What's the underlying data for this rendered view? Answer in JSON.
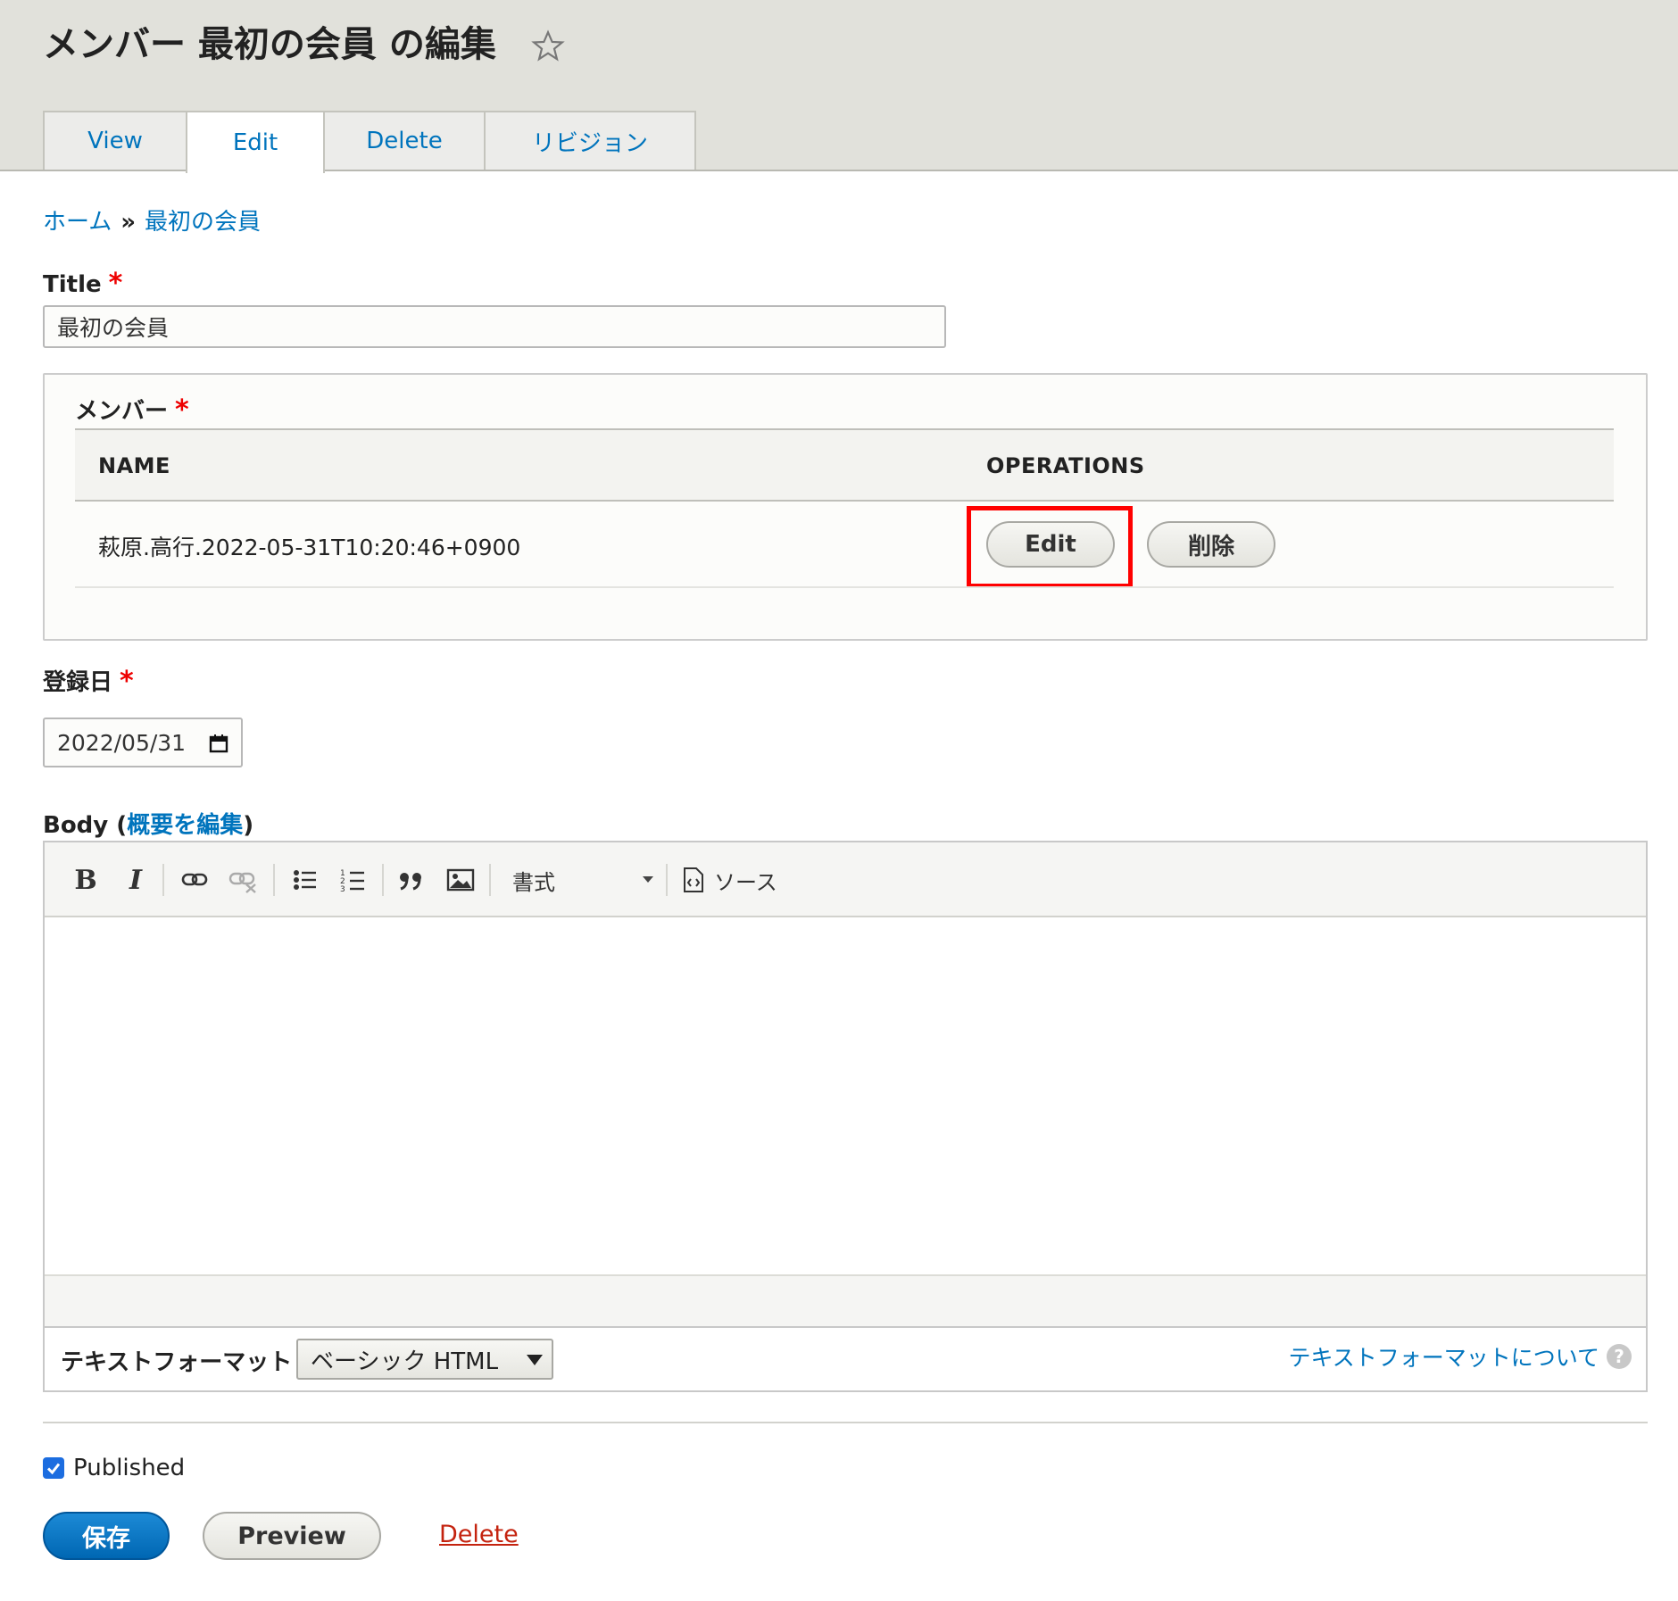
{
  "header": {
    "title": "メンバー 最初の会員 の編集",
    "tabs": [
      {
        "label": "View",
        "active": false
      },
      {
        "label": "Edit",
        "active": true
      },
      {
        "label": "Delete",
        "active": false
      },
      {
        "label": "リビジョン",
        "active": false
      }
    ]
  },
  "breadcrumb": {
    "items": [
      "ホーム",
      "最初の会員"
    ],
    "separator": "»"
  },
  "title_field": {
    "label": "Title",
    "required_mark": "*",
    "value": "最初の会員"
  },
  "member_field": {
    "label": "メンバー",
    "required_mark": "*",
    "columns": [
      "NAME",
      "OPERATIONS"
    ],
    "rows": [
      {
        "name": "萩原.高行.2022-05-31T10:20:46+0900",
        "edit_label": "Edit",
        "delete_label": "削除"
      }
    ]
  },
  "date_field": {
    "label": "登録日",
    "required_mark": "*",
    "value": "2022/05/31"
  },
  "body_field": {
    "label": "Body",
    "summary_link": "概要を編集",
    "toolbar": {
      "bold": "B",
      "italic": "I",
      "format_label": "書式",
      "source_label": "ソース"
    },
    "text_format_label": "テキストフォーマット",
    "text_format_value": "ベーシック HTML",
    "text_format_help": "テキストフォーマットについて",
    "help_icon": "?"
  },
  "published": {
    "label": "Published",
    "checked": true
  },
  "actions": {
    "save": "保存",
    "preview": "Preview",
    "delete": "Delete"
  },
  "colors": {
    "link": "#0074bd",
    "primary": "#0067b3",
    "danger": "#c4230f",
    "highlight": "#ff0000",
    "required": "#ee0000"
  }
}
